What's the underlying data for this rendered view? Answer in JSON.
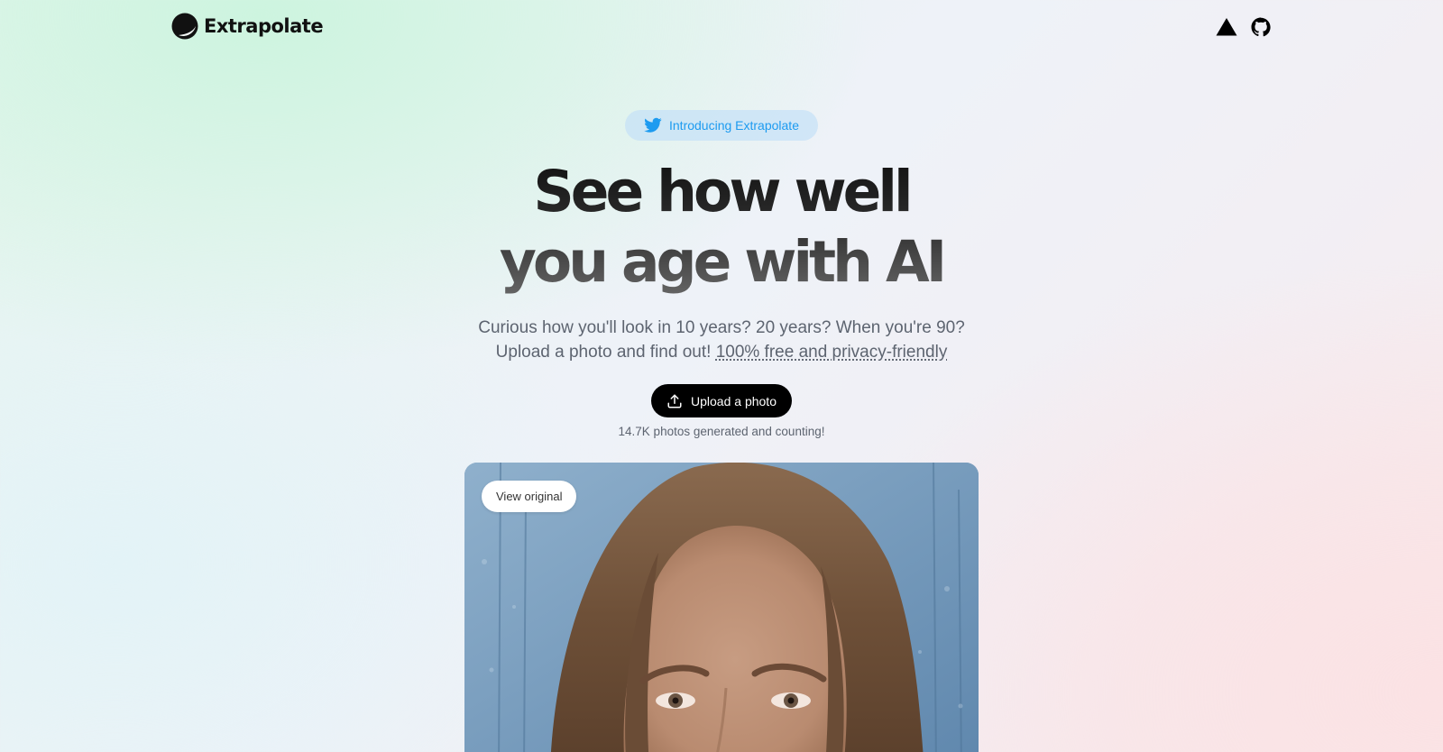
{
  "header": {
    "brand": "Extrapolate",
    "icons": [
      "vercel-icon",
      "github-icon"
    ]
  },
  "hero": {
    "announcement": "Introducing Extrapolate",
    "headline_line1": "See how well",
    "headline_line2": "you age with AI",
    "subtitle_line1": "Curious how you'll look in 10 years? 20 years? When you're 90?",
    "subtitle_line2_prefix": "Upload a photo and find out!",
    "subtitle_link": "100% free and privacy-friendly",
    "upload_label": "Upload a photo",
    "counter": "14.7K photos generated and counting!"
  },
  "photo": {
    "toggle_label": "View original"
  },
  "colors": {
    "twitter_blue": "#1d9bf0",
    "button_black": "#000000",
    "pill_bg": "#c1def8"
  }
}
